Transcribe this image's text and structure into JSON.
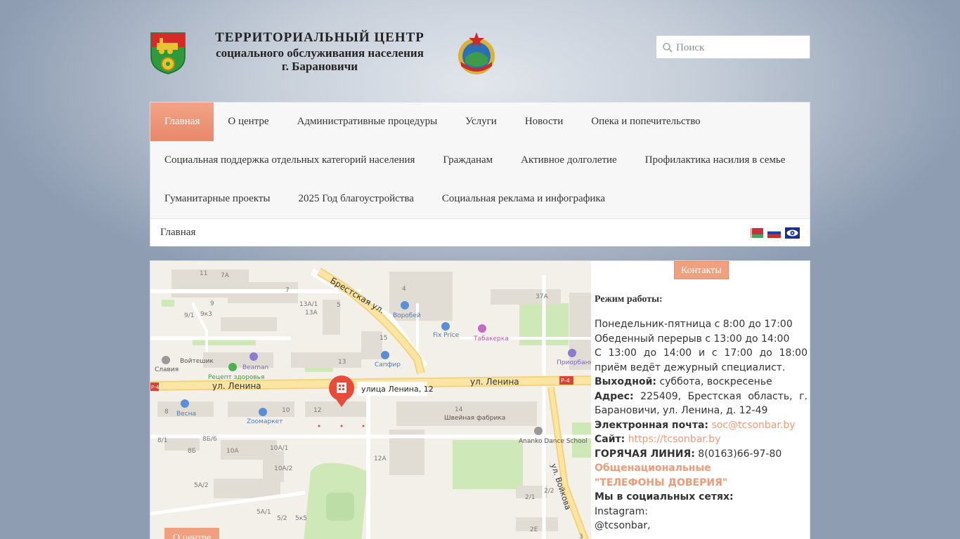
{
  "header": {
    "title_line1": "ТЕРРИТОРИАЛЬНЫЙ ЦЕНТР",
    "title_line2": "социального обслуживания населения",
    "title_line3": "г. Барановичи",
    "search_placeholder": "Поиск"
  },
  "nav": {
    "row1": [
      "Главная",
      "О центре",
      "Административные процедуры",
      "Услуги",
      "Новости",
      "Опека и попечительство"
    ],
    "row2": [
      "Социальная поддержка отдельных категорий населения",
      "Гражданам",
      "Активное долголетие",
      "Профилактика насилия в семье"
    ],
    "row3": [
      "Гуманитарные проекты",
      "2025 Год благоустройства",
      "Социальная реклама и инфографика"
    ],
    "active": "Главная"
  },
  "breadcrumb": "Главная",
  "map": {
    "labels": {
      "brestskaya": "Брестская ул.",
      "lenina_left": "ул. Ленина",
      "lenina_right": "ул. Ленина",
      "voykova": "ул. Войкова",
      "pin": "улица Ленина, 12",
      "vorobey": "Воробей",
      "fixprice": "Fix Price",
      "tabakerka": "Табакерка",
      "priorbank": "Приорбанк",
      "slavia": "Славия",
      "voyteshik": "Войтешик",
      "beaman": "Beaman",
      "recept": "Рецепт здоровья",
      "sapfir": "Сапфир",
      "vesna": "Весна",
      "zoomarket": "Zooмаркет",
      "shveynaya": "Швейная фабрика",
      "ananko": "Ananko Dance School",
      "r4_left": "Р-4",
      "r4_right": "Р-4"
    },
    "house_numbers": [
      "11",
      "7А",
      "7",
      "9",
      "9/1",
      "9к3",
      "13А/1",
      "13А",
      "5",
      "4",
      "37А",
      "13",
      "15",
      "12",
      "10",
      "8",
      "14",
      "8/1",
      "8Б",
      "8Б/6",
      "10А",
      "10А/1",
      "10А/2",
      "5А/2",
      "5А/1",
      "5/2",
      "5к5",
      "12А",
      "2/1",
      "2/2",
      "2Е",
      "3"
    ]
  },
  "contacts": {
    "button": "Контакты",
    "heading": "Режим работы:",
    "hours1": "Понедельник-пятница с 8:00 до 17:00",
    "hours2": "Обеденный перерыв с 13:00 до 14:00",
    "hours3": "С 13:00 до 14:00 и с 17:00 до 18:00 приём ведёт дежурный специалист.",
    "weekend_label": "Выходной:",
    "weekend_value": "суббота, воскресенье",
    "address_label": "Адрес:",
    "address_value": "225409, Брестская область, г. Барановичи, ул. Ленина, д. 12-49",
    "email_label": "Электронная почта:",
    "email_value": "soc@tcsonbar.by",
    "site_label": "Сайт:",
    "site_value": "https://tcsonbar.by",
    "hotline_label": "ГОРЯЧАЯ ЛИНИЯ:",
    "hotline_value": "8(0163)66-97-80",
    "trust_line1": "Общенациональные",
    "trust_line2": "\"ТЕЛЕФОНЫ ДОВЕРИЯ\"",
    "social_label": "Мы в социальных сетях:",
    "instagram_label": "Instagram:",
    "instagram_value": "@tcsonbar,"
  },
  "about_button": "О центре",
  "colors": {
    "accent": "#ef9a79",
    "nav_bg": "#f7f7f7",
    "active_nav": "#e8876a"
  }
}
